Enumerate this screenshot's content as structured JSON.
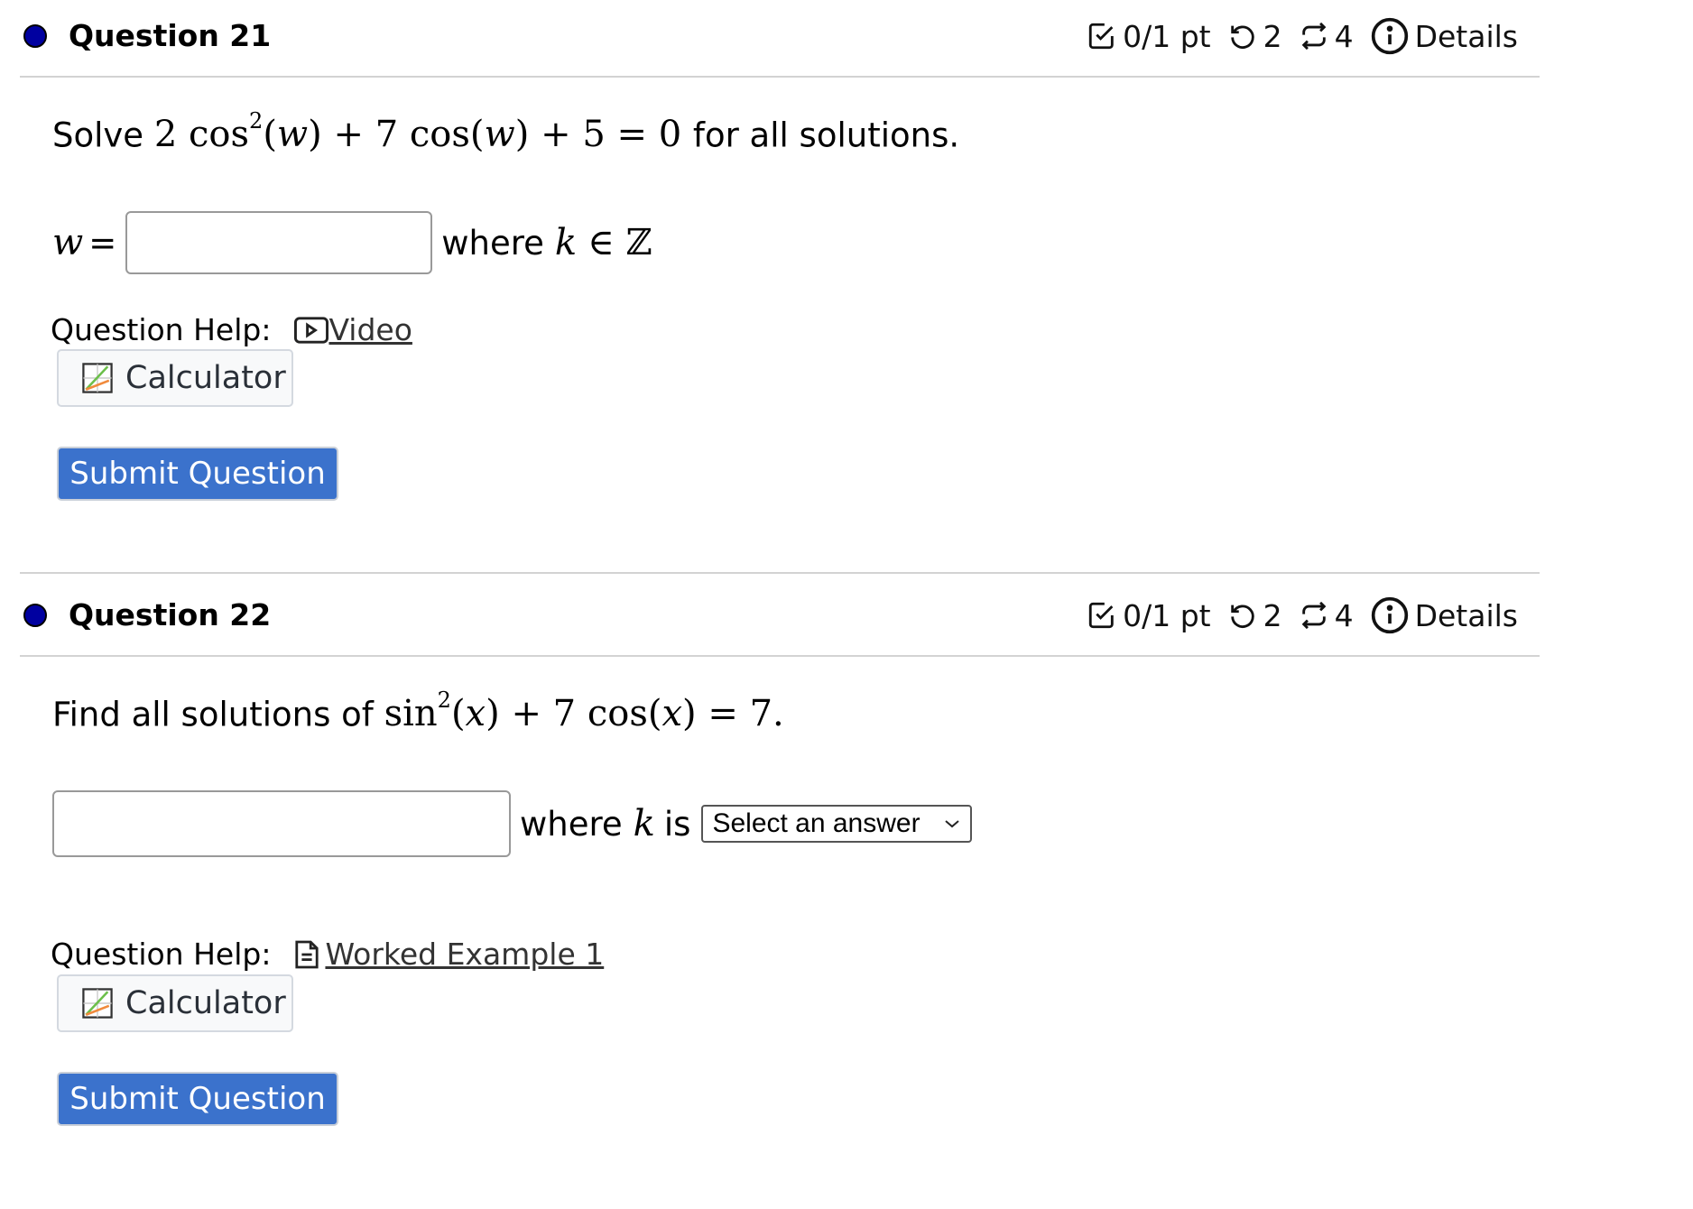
{
  "questions": [
    {
      "title": "Question 21",
      "score": "0/1 pt",
      "retries": "2",
      "attempts": "4",
      "details_label": "Details",
      "prompt_prefix": "Solve",
      "prompt_math": {
        "coef1": "2",
        "func1": "cos",
        "exp": "2",
        "var": "w",
        "plus1": "+",
        "coef2": "7",
        "func2": "cos",
        "plus2": "+",
        "const": "5",
        "eq": "=",
        "rhs": "0"
      },
      "prompt_suffix": "for all solutions.",
      "answer_label_var": "w",
      "answer_label_eq": "=",
      "answer_value": "",
      "answer_after": "where",
      "answer_after_var": "k",
      "answer_after_set": "∈ ℤ",
      "help_label": "Question Help:",
      "help_link": "Video",
      "help_icon": "video-icon",
      "calculator_label": "Calculator",
      "submit_label": "Submit Question"
    },
    {
      "title": "Question 22",
      "score": "0/1 pt",
      "retries": "2",
      "attempts": "4",
      "details_label": "Details",
      "prompt_prefix": "Find all solutions of",
      "prompt_math": {
        "func1": "sin",
        "exp": "2",
        "var": "x",
        "plus1": "+",
        "coef2": "7",
        "func2": "cos",
        "eq": "=",
        "rhs": "7."
      },
      "answer_value": "",
      "answer_after": "where",
      "answer_after_var": "k",
      "answer_after_is": "is",
      "select_value": "Select an answer",
      "help_label": "Question Help:",
      "help_link": "Worked Example 1",
      "help_icon": "document-icon",
      "calculator_label": "Calculator",
      "submit_label": "Submit Question"
    }
  ],
  "colors": {
    "status_dot": "#0000a0",
    "submit_bg": "#3b72cc",
    "divider": "#d3d3d3"
  }
}
